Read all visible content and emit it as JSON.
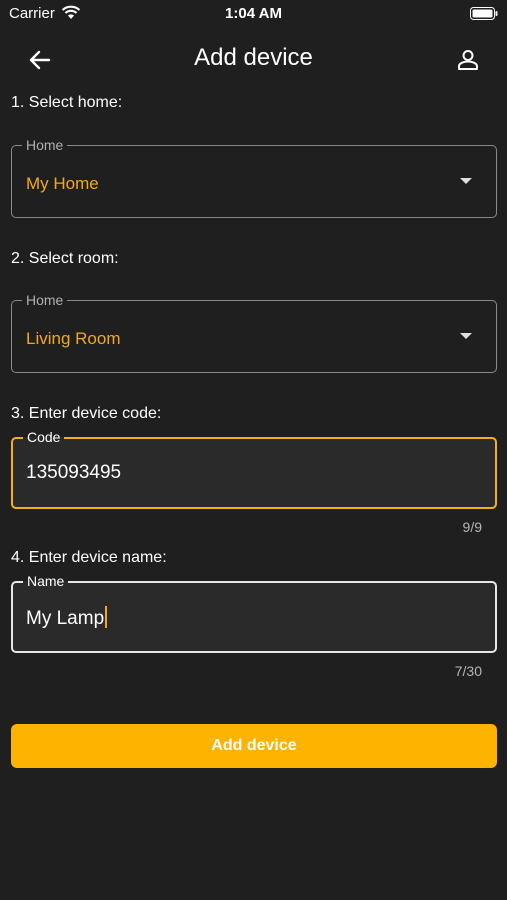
{
  "status_bar": {
    "carrier": "Carrier",
    "time": "1:04 AM"
  },
  "header": {
    "title": "Add device"
  },
  "steps": {
    "home": "1. Select home:",
    "room": "2. Select room:",
    "code": "3. Enter device code:",
    "name": "4. Enter device name:"
  },
  "home_field": {
    "label": "Home",
    "value": "My Home"
  },
  "room_field": {
    "label": "Home",
    "value": "Living Room"
  },
  "code_field": {
    "label": "Code",
    "value": "135093495",
    "counter": "9/9"
  },
  "name_field": {
    "label": "Name",
    "value": "My Lamp",
    "counter": "7/30"
  },
  "submit": {
    "label": "Add device"
  },
  "colors": {
    "accent": "#fdb300",
    "background": "#1f1f1f",
    "value_text": "#f2a81d"
  },
  "icons": [
    "wifi-icon",
    "battery-icon",
    "back-arrow-icon",
    "person-icon",
    "dropdown-arrow-icon"
  ]
}
